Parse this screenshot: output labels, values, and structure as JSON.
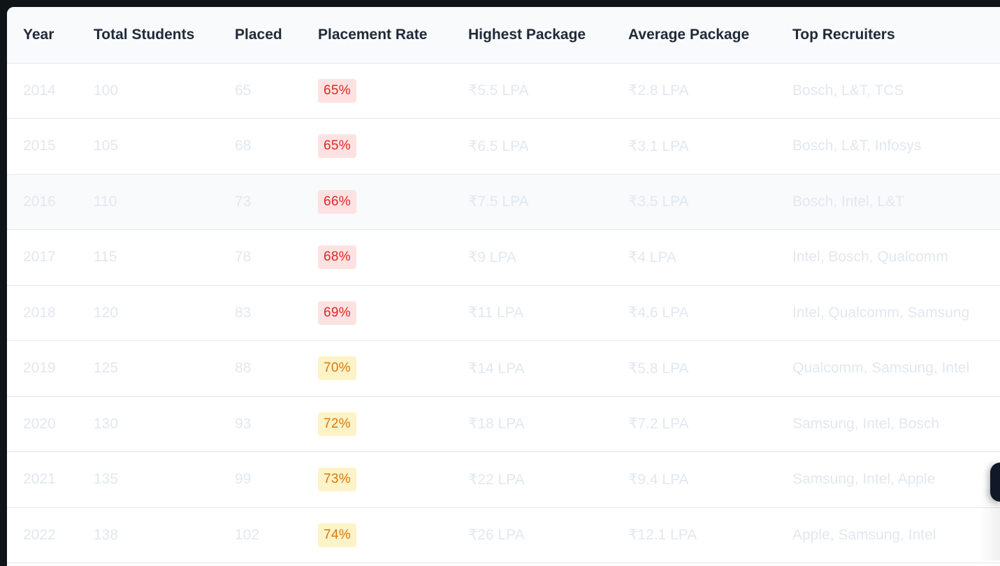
{
  "table": {
    "headers": [
      "Year",
      "Total Students",
      "Placed",
      "Placement Rate",
      "Highest Package",
      "Average Package",
      "Top Recruiters"
    ],
    "rows": [
      {
        "year": "2014",
        "total": "100",
        "placed": "65",
        "rate": "65%",
        "rate_level": "low",
        "highest": "₹5.5 LPA",
        "average": "₹2.8 LPA",
        "recruiters": "Bosch, L&T, TCS"
      },
      {
        "year": "2015",
        "total": "105",
        "placed": "68",
        "rate": "65%",
        "rate_level": "low",
        "highest": "₹6.5 LPA",
        "average": "₹3.1 LPA",
        "recruiters": "Bosch, L&T, Infosys"
      },
      {
        "year": "2016",
        "total": "110",
        "placed": "73",
        "rate": "66%",
        "rate_level": "low",
        "highest": "₹7.5 LPA",
        "average": "₹3.5 LPA",
        "recruiters": "Bosch, Intel, L&T"
      },
      {
        "year": "2017",
        "total": "115",
        "placed": "78",
        "rate": "68%",
        "rate_level": "low",
        "highest": "₹9 LPA",
        "average": "₹4 LPA",
        "recruiters": "Intel, Bosch, Qualcomm"
      },
      {
        "year": "2018",
        "total": "120",
        "placed": "83",
        "rate": "69%",
        "rate_level": "low",
        "highest": "₹11 LPA",
        "average": "₹4.6 LPA",
        "recruiters": "Intel, Qualcomm, Samsung"
      },
      {
        "year": "2019",
        "total": "125",
        "placed": "88",
        "rate": "70%",
        "rate_level": "mid",
        "highest": "₹14 LPA",
        "average": "₹5.8 LPA",
        "recruiters": "Qualcomm, Samsung, Intel"
      },
      {
        "year": "2020",
        "total": "130",
        "placed": "93",
        "rate": "72%",
        "rate_level": "mid",
        "highest": "₹18 LPA",
        "average": "₹7.2 LPA",
        "recruiters": "Samsung, Intel, Bosch"
      },
      {
        "year": "2021",
        "total": "135",
        "placed": "99",
        "rate": "73%",
        "rate_level": "mid",
        "highest": "₹22 LPA",
        "average": "₹9.4 LPA",
        "recruiters": "Samsung, Intel, Apple"
      },
      {
        "year": "2022",
        "total": "138",
        "placed": "102",
        "rate": "74%",
        "rate_level": "mid",
        "highest": "₹26 LPA",
        "average": "₹12.1 LPA",
        "recruiters": "Apple, Samsung, Intel"
      }
    ],
    "hovered_row_index": 2
  },
  "colors": {
    "page_background": "#0f1419",
    "header_background": "#f8fafc",
    "header_text": "#1f2937",
    "cell_text_faded": "#e2e8f0",
    "badge_low_bg": "#fee2e2",
    "badge_low_text": "#dc2626",
    "badge_mid_bg": "#fef3c7",
    "badge_mid_text": "#d97706"
  }
}
